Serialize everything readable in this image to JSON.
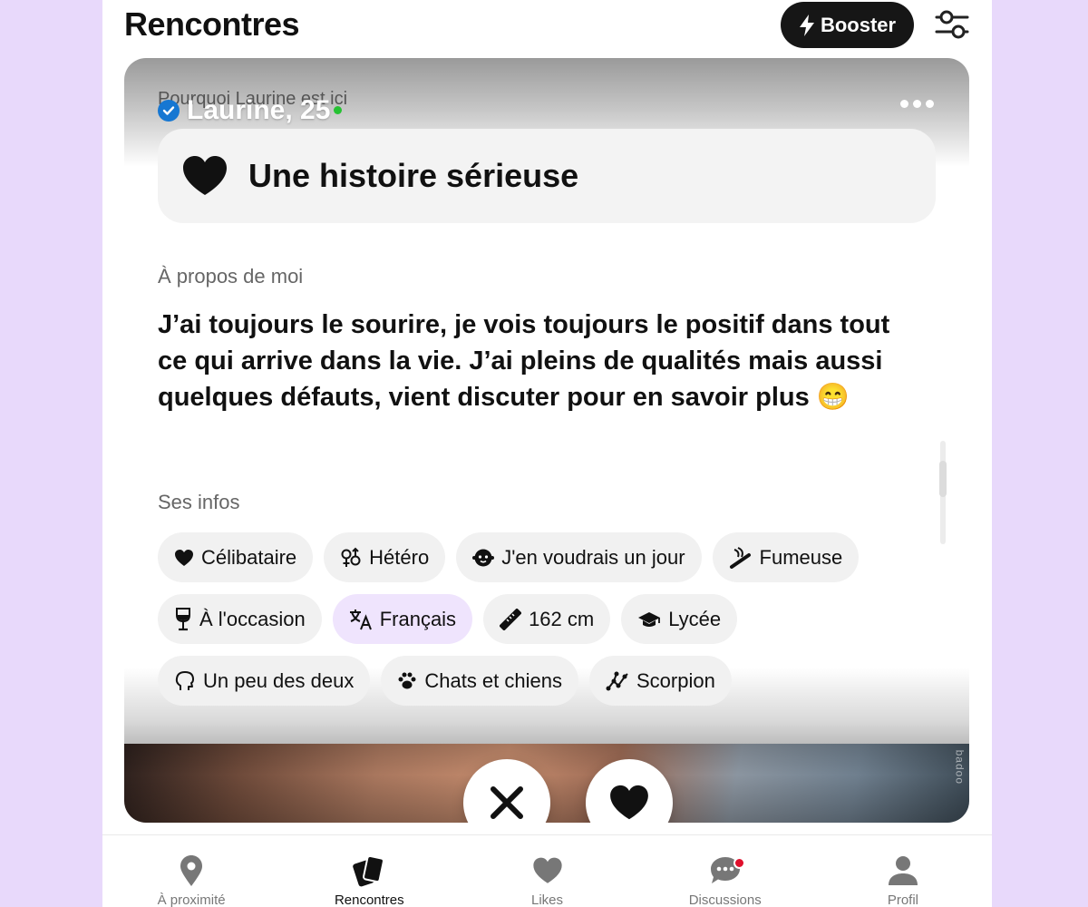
{
  "header": {
    "title": "Rencontres",
    "booster_label": "Booster",
    "booster_icon": "lightning-icon",
    "filters_icon": "sliders-icon"
  },
  "profile": {
    "name_age": "Laurine, 25",
    "verified": true,
    "online": true,
    "why_label": "Pourquoi Laurine est ici",
    "intent": "Une histoire sérieuse",
    "about_label": "À propos de moi",
    "about_text": "J’ai toujours le sourire, je vois toujours le positif dans tout ce qui arrive dans la vie. J’ai pleins de qualités mais aussi quelques défauts, vient discuter pour en savoir plus 😁",
    "infos_label": "Ses infos",
    "chips": [
      {
        "label": "Célibataire",
        "icon": "heart-icon"
      },
      {
        "label": "Hétéro",
        "icon": "gender-icon"
      },
      {
        "label": "J'en voudrais un jour",
        "icon": "baby-icon"
      },
      {
        "label": "Fumeuse",
        "icon": "cigarette-icon"
      },
      {
        "label": "À l'occasion",
        "icon": "wine-glass-icon"
      },
      {
        "label": "Français",
        "icon": "translate-icon",
        "highlighted": true
      },
      {
        "label": "162 cm",
        "icon": "ruler-icon"
      },
      {
        "label": "Lycée",
        "icon": "graduation-cap-icon"
      },
      {
        "label": "Un peu des deux",
        "icon": "head-icon"
      },
      {
        "label": "Chats et chiens",
        "icon": "paw-icon"
      },
      {
        "label": "Scorpion",
        "icon": "constellation-icon"
      }
    ],
    "photo_watermark": "badoo"
  },
  "actions": {
    "pass_icon": "close-icon",
    "like_icon": "heart-icon"
  },
  "nav": {
    "items": [
      {
        "label": "À proximité",
        "icon": "location-pin-icon"
      },
      {
        "label": "Rencontres",
        "icon": "cards-icon",
        "active": true
      },
      {
        "label": "Likes",
        "icon": "heart-icon"
      },
      {
        "label": "Discussions",
        "icon": "chat-bubble-icon",
        "badge": true
      },
      {
        "label": "Profil",
        "icon": "person-icon"
      }
    ]
  },
  "colors": {
    "background": "#e8d9fb",
    "booster": "#161616",
    "verified": "#1677d2",
    "online": "#26c233",
    "chip": "#f1f1f1",
    "chip_highlight": "#efe4fd",
    "badge": "#e0102c"
  }
}
